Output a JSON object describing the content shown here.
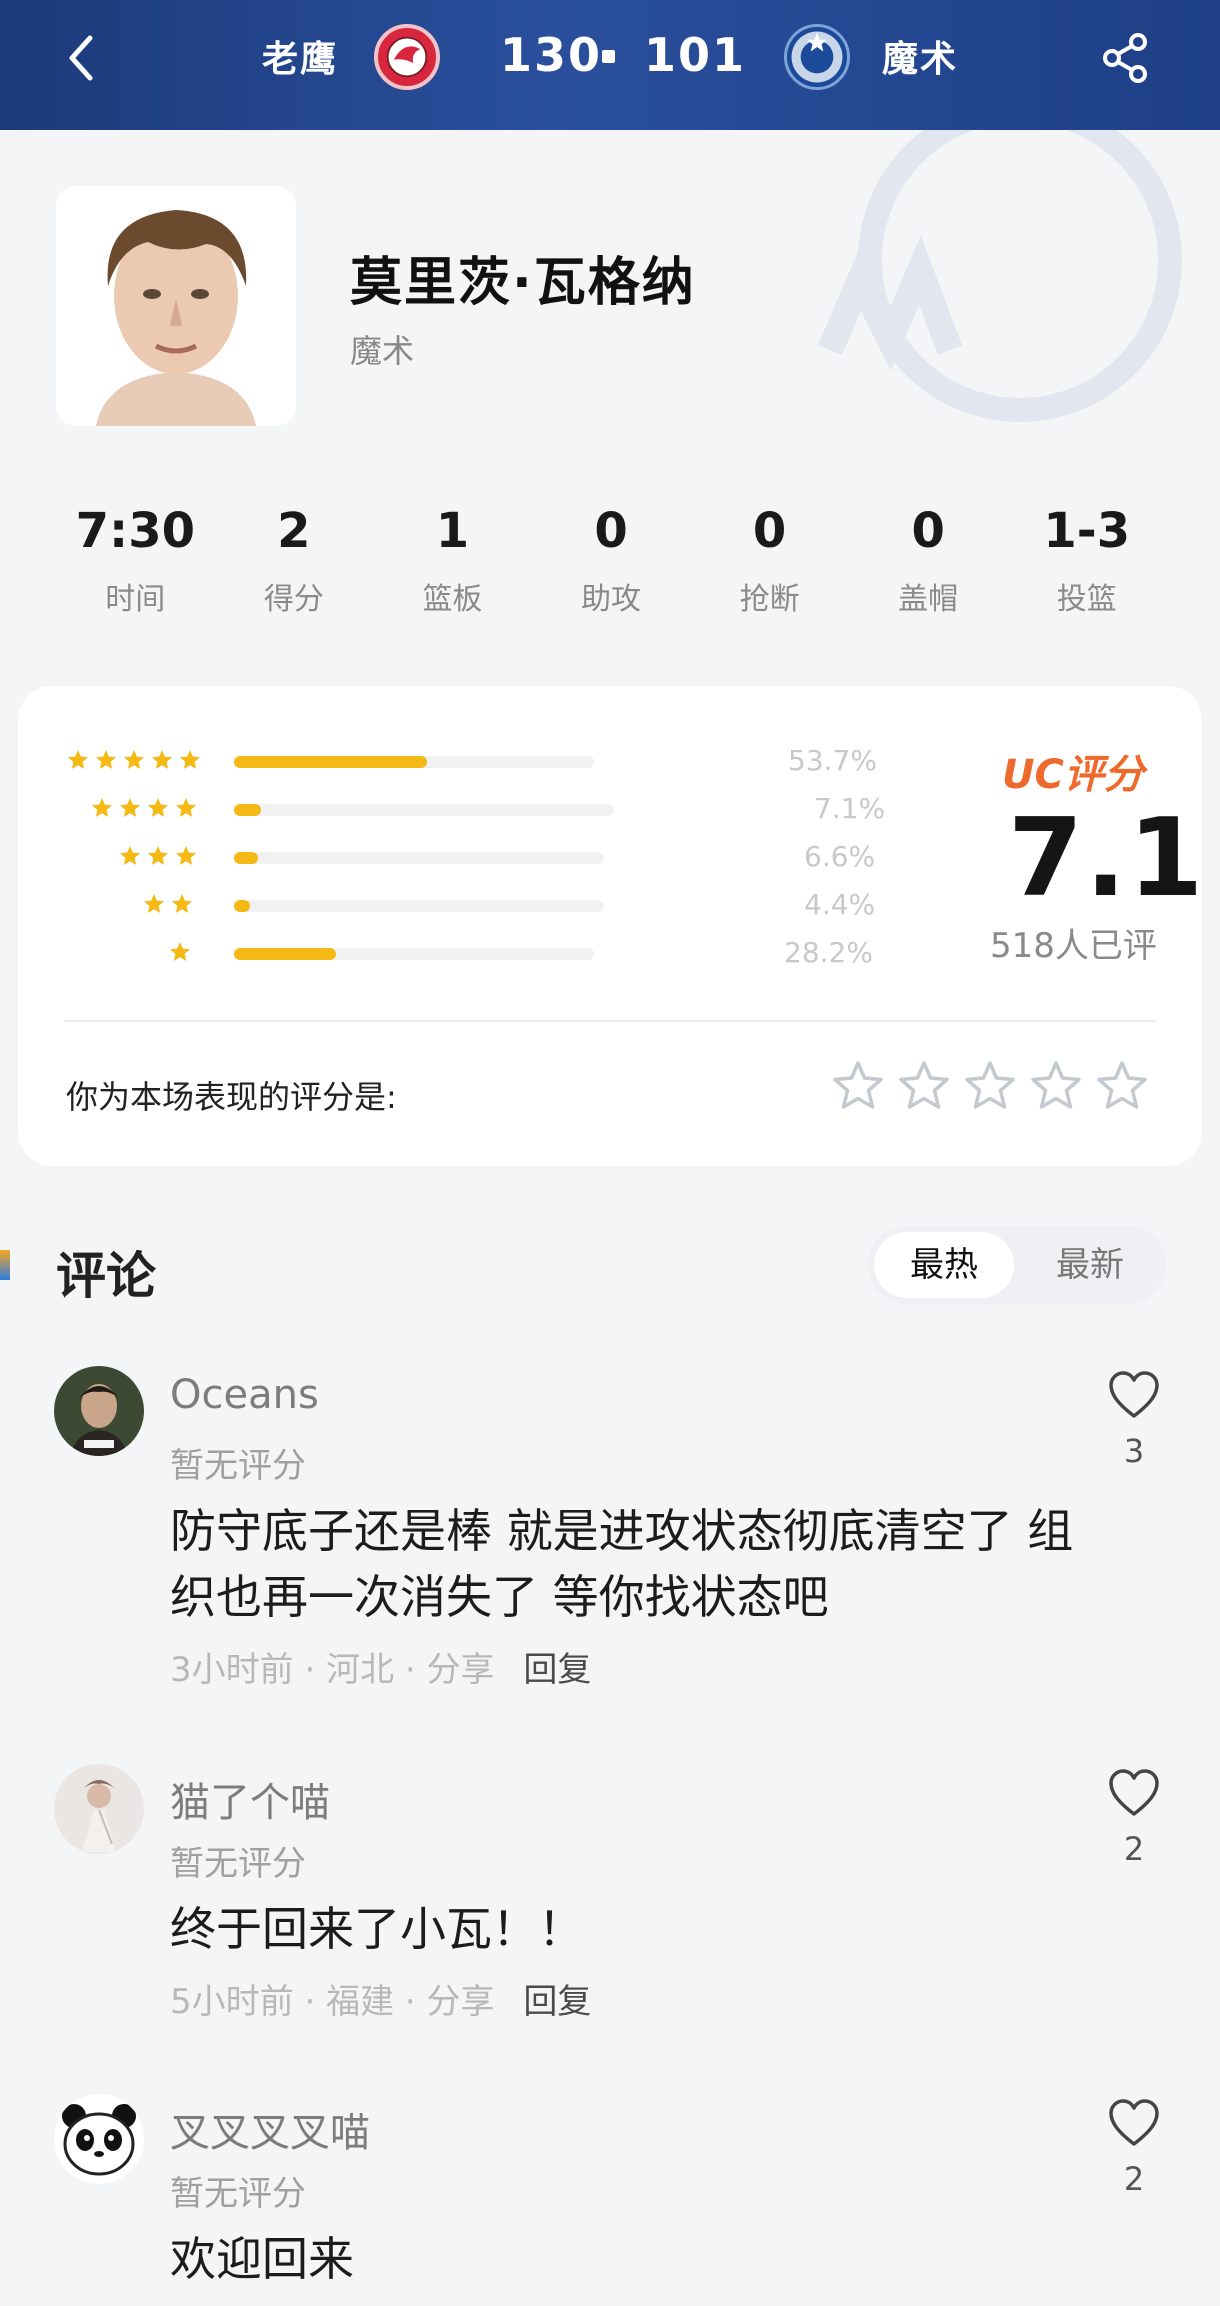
{
  "header": {
    "team_left": "老鹰",
    "score_left": "130",
    "score_right": "101",
    "team_right": "魔术"
  },
  "player": {
    "name": "莫里茨·瓦格纳",
    "team": "魔术"
  },
  "stats": [
    {
      "value": "7:30",
      "label": "时间"
    },
    {
      "value": "2",
      "label": "得分"
    },
    {
      "value": "1",
      "label": "篮板"
    },
    {
      "value": "0",
      "label": "助攻"
    },
    {
      "value": "0",
      "label": "抢断"
    },
    {
      "value": "0",
      "label": "盖帽"
    },
    {
      "value": "1-3",
      "label": "投篮"
    }
  ],
  "rating": {
    "distribution": [
      {
        "stars": 5,
        "pct": "53.7%",
        "value": 53.7
      },
      {
        "stars": 4,
        "pct": "7.1%",
        "value": 7.1
      },
      {
        "stars": 3,
        "pct": "6.6%",
        "value": 6.6
      },
      {
        "stars": 2,
        "pct": "4.4%",
        "value": 4.4
      },
      {
        "stars": 1,
        "pct": "28.2%",
        "value": 28.2
      }
    ],
    "uc_label": "UC评分",
    "score": "7.1",
    "count": "518人已评",
    "prompt": "你为本场表现的评分是:"
  },
  "comments": {
    "title": "评论",
    "sort_hot": "最热",
    "sort_new": "最新",
    "items": [
      {
        "user": "Oceans",
        "rating": "暂无评分",
        "text": "防守底子还是棒 就是进攻状态彻底清空了 组织也再一次消失了 等你找状态吧",
        "time": "3小时前",
        "location": "河北",
        "share": "分享",
        "reply": "回复",
        "likes": "3"
      },
      {
        "user": "猫了个喵",
        "rating": "暂无评分",
        "text": "终于回来了小瓦！！",
        "time": "5小时前",
        "location": "福建",
        "share": "分享",
        "reply": "回复",
        "likes": "2"
      },
      {
        "user": "叉叉叉叉喵",
        "rating": "暂无评分",
        "text": "欢迎回来",
        "likes": "2"
      }
    ]
  },
  "colors": {
    "header_bg": "#23468f",
    "bar_fill": "#f5b915",
    "uc_orange": "#ee6a2c"
  }
}
